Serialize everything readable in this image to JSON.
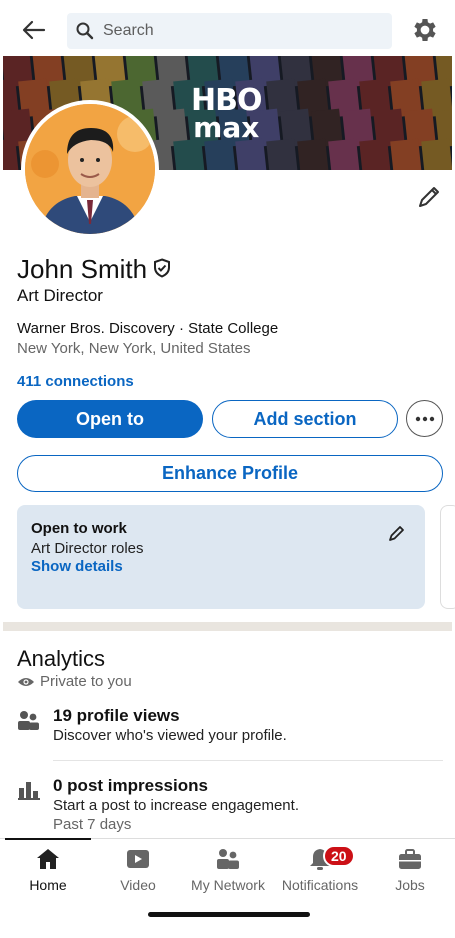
{
  "search": {
    "placeholder": "Search"
  },
  "banner": {
    "logo_top": "HBO",
    "logo_bottom": "max"
  },
  "profile": {
    "name": "John Smith",
    "headline": "Art Director",
    "company_line": "Warner Bros. Discovery · State College",
    "location": "New York, New York, United States",
    "connections": "411 connections"
  },
  "actions": {
    "open_to": "Open to",
    "add_section": "Add section",
    "more": "···",
    "enhance": "Enhance Profile"
  },
  "open_to_work": {
    "title": "Open to work",
    "roles": "Art Director roles",
    "details_link": "Show details"
  },
  "analytics": {
    "title": "Analytics",
    "privacy": "Private to you",
    "items": [
      {
        "headline": "19 profile views",
        "sub": "Discover who's viewed your profile."
      },
      {
        "headline": "0 post impressions",
        "sub": "Start a post to increase engagement.",
        "sub2": "Past 7 days"
      }
    ]
  },
  "nav": {
    "items": [
      {
        "label": "Home",
        "icon": "home-icon"
      },
      {
        "label": "Video",
        "icon": "video-icon"
      },
      {
        "label": "My Network",
        "icon": "network-icon"
      },
      {
        "label": "Notifications",
        "icon": "bell-icon",
        "badge": "20"
      },
      {
        "label": "Jobs",
        "icon": "briefcase-icon"
      }
    ]
  },
  "colors": {
    "accent": "#0a66c2",
    "badge": "#cc1016",
    "card_bg": "#dde7f1"
  }
}
